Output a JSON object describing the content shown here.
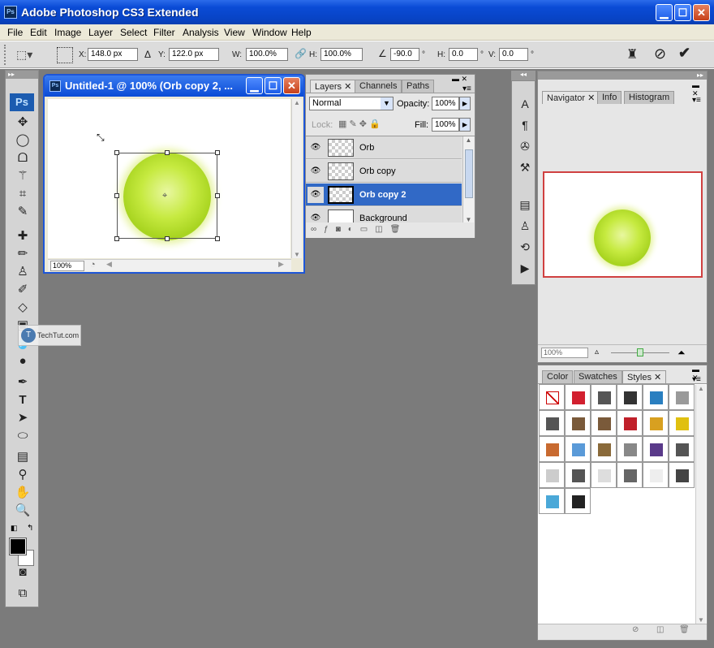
{
  "app": {
    "title": "Adobe Photoshop CS3 Extended",
    "logo": "Ps"
  },
  "menu": [
    "File",
    "Edit",
    "Image",
    "Layer",
    "Select",
    "Filter",
    "Analysis",
    "View",
    "Window",
    "Help"
  ],
  "options": {
    "x_label": "X:",
    "x_value": "148.0 px",
    "y_label": "Y:",
    "y_value": "122.0 px",
    "w_label": "W:",
    "w_value": "100.0%",
    "h_label": "H:",
    "h_value": "100.0%",
    "angle_value": "-90.0",
    "deg": "°",
    "hskew_label": "H:",
    "hskew_value": "0.0",
    "vskew_label": "V:",
    "vskew_value": "0.0"
  },
  "toolbox": {
    "logo": "Ps"
  },
  "document": {
    "title": "Untitled-1 @ 100% (Orb copy 2, ...",
    "zoom": "100%",
    "watermark": "TechTut.com"
  },
  "layers": {
    "tabs": [
      "Layers",
      "Channels",
      "Paths"
    ],
    "blend_mode": "Normal",
    "opacity_label": "Opacity:",
    "opacity": "100%",
    "lock_label": "Lock:",
    "fill_label": "Fill:",
    "fill": "100%",
    "items": [
      {
        "name": "Orb",
        "selected": false
      },
      {
        "name": "Orb copy",
        "selected": false
      },
      {
        "name": "Orb copy 2",
        "selected": true
      },
      {
        "name": "Background",
        "selected": false
      }
    ]
  },
  "navigator": {
    "tabs": [
      "Navigator",
      "Info",
      "Histogram"
    ],
    "zoom": "100%"
  },
  "styles": {
    "tabs": [
      "Color",
      "Swatches",
      "Styles"
    ],
    "swatches": [
      "#ffffff",
      "#d2202f",
      "#555555",
      "#333333",
      "#2a7fc0",
      "#9a9a9a",
      "#555555",
      "#7a5a3a",
      "#7a5a3a",
      "#c0202a",
      "#d8a020",
      "#e0c010",
      "#c86a30",
      "#5a9ad8",
      "#8a6a3a",
      "#888888",
      "#5a3a8a",
      "#555555",
      "#cccccc",
      "#555555",
      "#dddddd",
      "#666666",
      "#eeeeee",
      "#444444",
      "#4aa8d8",
      "#222222"
    ]
  },
  "colors": {
    "titlebar": "#0a4bd6",
    "selection": "#3169c6",
    "workspace": "#7b7b7b",
    "orb": "#b5e02a",
    "nav_frame": "#d04040"
  }
}
